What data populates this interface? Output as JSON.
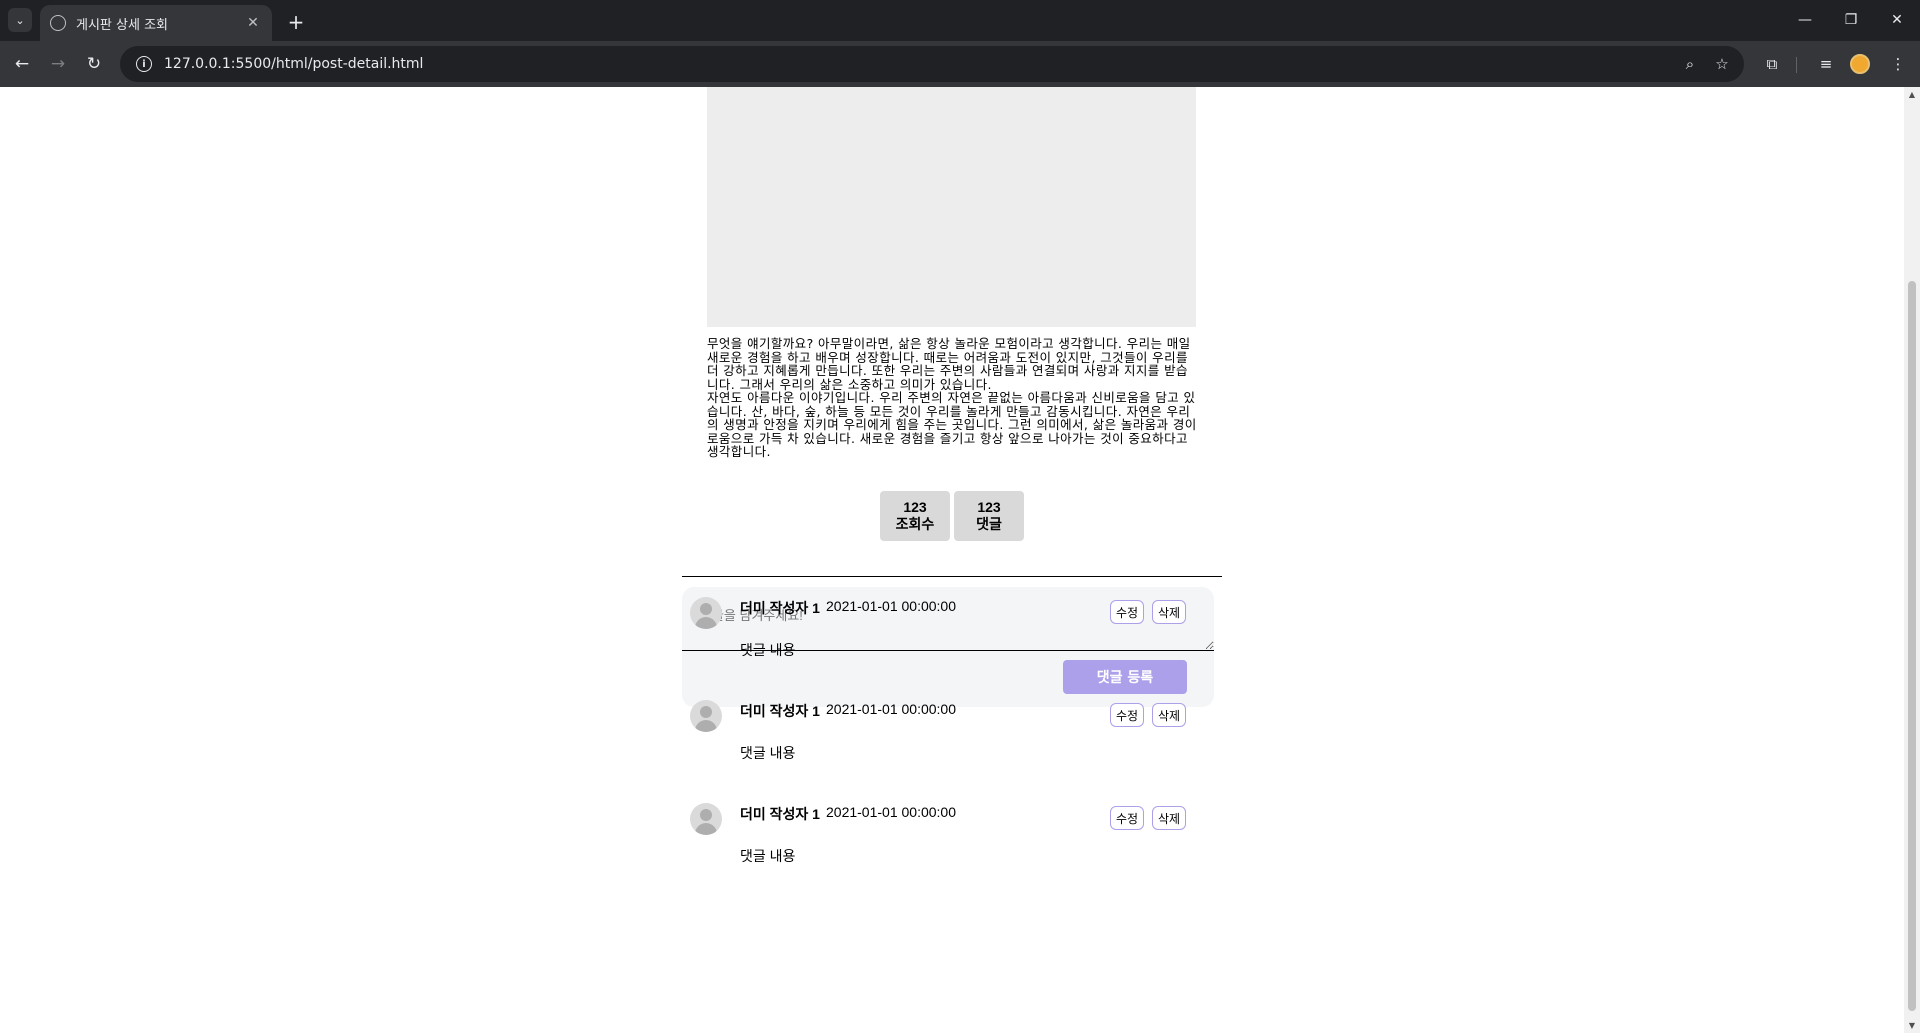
{
  "browser": {
    "tab_title": "게시판 상세 조회",
    "url": "127.0.0.1:5500/html/post-detail.html",
    "tab_search_icon": "chevron-down-icon",
    "new_tab_label": "+",
    "tab_close_label": "✕"
  },
  "post": {
    "paragraphs": [
      "무엇을 얘기할까요? 아무말이라면, 삶은 항상 놀라운 모험이라고 생각합니다. 우리는 매일 새로운 경험을 하고 배우며 성장합니다. 때로는 어려움과 도전이 있지만, 그것들이 우리를 더 강하고 지혜롭게 만듭니다. 또한 우리는 주변의 사람들과 연결되며 사랑과 지지를 받습니다. 그래서 우리의 삶은 소중하고 의미가 있습니다.",
      "자연도 아름다운 이야기입니다. 우리 주변의 자연은 끝없는 아름다움과 신비로움을 담고 있습니다. 산, 바다, 숲, 하늘 등 모든 것이 우리를 놀라게 만들고 감동시킵니다. 자연은 우리의 생명과 안정을 지키며 우리에게 힘을 주는 곳입니다. 그런 의미에서, 삶은 놀라움과 경이로움으로 가득 차 있습니다. 새로운 경험을 즐기고 항상 앞으로 나아가는 것이 중요하다고 생각합니다."
    ],
    "views": {
      "count": "123",
      "label": "조회수"
    },
    "comments_count": {
      "count": "123",
      "label": "댓글"
    }
  },
  "comment_form": {
    "placeholder": "댓글을 남겨주세요!",
    "submit_label": "댓글 등록"
  },
  "comments": [
    {
      "author": "더미 작성자 1",
      "date": "2021-01-01 00:00:00",
      "content": "댓글 내용",
      "edit_label": "수정",
      "delete_label": "삭제"
    },
    {
      "author": "더미 작성자 1",
      "date": "2021-01-01 00:00:00",
      "content": "댓글 내용",
      "edit_label": "수정",
      "delete_label": "삭제"
    },
    {
      "author": "더미 작성자 1",
      "date": "2021-01-01 00:00:00",
      "content": "댓글 내용",
      "edit_label": "수정",
      "delete_label": "삭제"
    }
  ],
  "colors": {
    "accent": "#aca0eb",
    "image_placeholder": "#ededed",
    "stat_box": "#d9d9d9",
    "comment_box": "#f4f5f7"
  }
}
